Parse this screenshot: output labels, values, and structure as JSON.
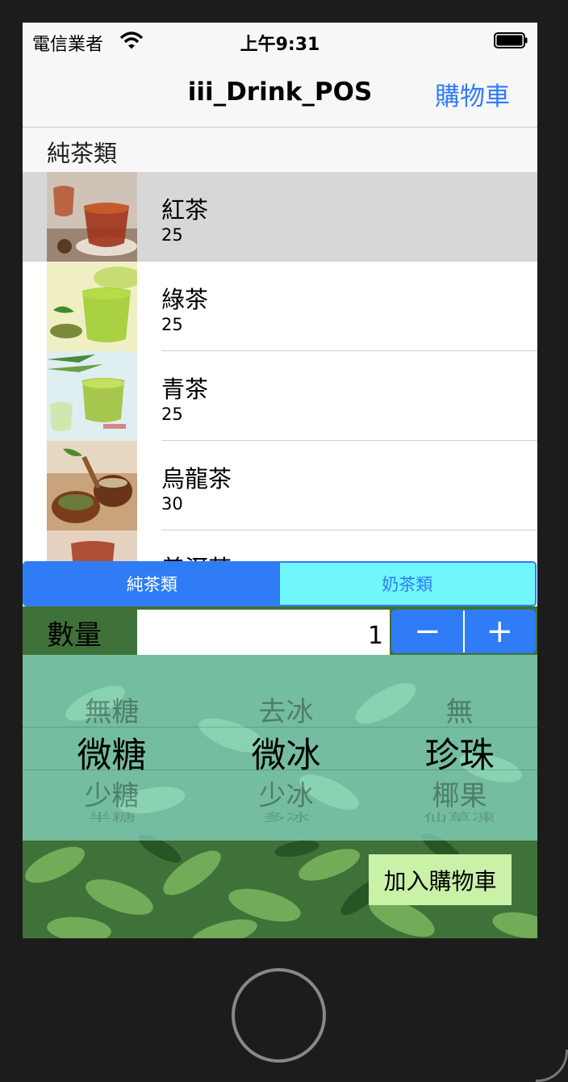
{
  "status_bar": {
    "carrier": "電信業者",
    "time": "上午9:31"
  },
  "nav": {
    "title": "iii_Drink_POS",
    "right_button": "購物車"
  },
  "section": {
    "header": "純茶類"
  },
  "drinks": [
    {
      "name": "紅茶",
      "price": "25"
    },
    {
      "name": "綠茶",
      "price": "25"
    },
    {
      "name": "青茶",
      "price": "25"
    },
    {
      "name": "烏龍茶",
      "price": "30"
    },
    {
      "name": "普洱茶",
      "price": ""
    }
  ],
  "segments": [
    "純茶類",
    "奶茶類"
  ],
  "quantity": {
    "label": "數量",
    "value": "1",
    "minus": "−",
    "plus": "+"
  },
  "picker": {
    "sugar": [
      "無糖",
      "微糖",
      "少糖",
      "半糖"
    ],
    "ice": [
      "去冰",
      "微冰",
      "少冰",
      "多冰"
    ],
    "topping": [
      "無",
      "珍珠",
      "椰果",
      "仙草凍"
    ]
  },
  "add_to_cart": "加入購物車",
  "colors": {
    "accent": "#2f7cf6",
    "segment_unselected": "#6ff7fc",
    "add_button": "#c9f1a8"
  },
  "icons": [
    "wifi-icon",
    "battery-icon"
  ]
}
